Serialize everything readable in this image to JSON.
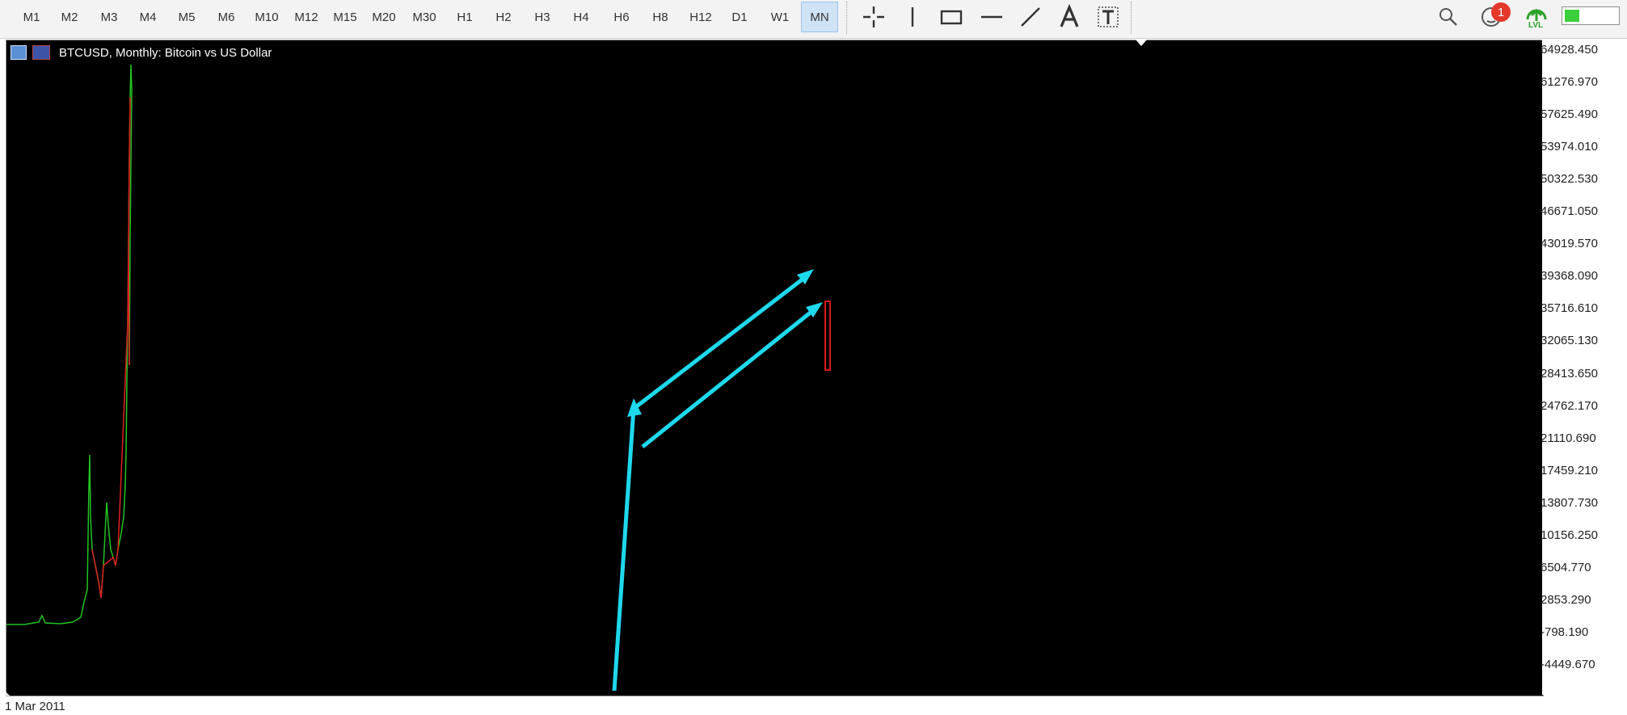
{
  "toolbar": {
    "timeframes": [
      "M1",
      "M2",
      "M3",
      "M4",
      "M5",
      "M6",
      "M10",
      "M12",
      "M15",
      "M20",
      "M30",
      "H1",
      "H2",
      "H3",
      "H4",
      "H6",
      "H8",
      "H12",
      "D1",
      "W1",
      "MN"
    ],
    "active_timeframe": "MN",
    "tools": [
      "crosshair-icon",
      "vertical-line-icon",
      "rectangle-icon",
      "horizontal-line-icon",
      "trendline-icon",
      "text-icon",
      "text-label-icon"
    ],
    "notification_count": "1",
    "lvl_label": "LVL",
    "battery_level": 0.28
  },
  "chart": {
    "title": "BTCUSD, Monthly:  Bitcoin vs US Dollar",
    "price_labels": [
      "64928.450",
      "61276.970",
      "57625.490",
      "53974.010",
      "50322.530",
      "46671.050",
      "43019.570",
      "39368.090",
      "35716.610",
      "32065.130",
      "28413.650",
      "24762.170",
      "21110.690",
      "17459.210",
      "13807.730",
      "10156.250",
      "6504.770",
      "2853.290",
      "-798.190",
      "-4449.670"
    ],
    "time_label": "1 Mar 2011",
    "colors": {
      "background": "#000000",
      "bull": "#22c322",
      "bear": "#e02020",
      "arrow": "#1ed8ec",
      "rectangle": "#d41a1a"
    }
  }
}
